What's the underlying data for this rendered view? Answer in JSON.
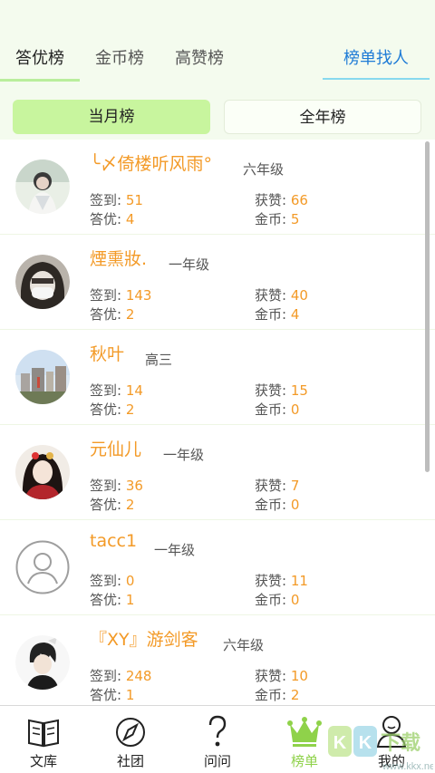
{
  "tabs": [
    {
      "label": "答优榜"
    },
    {
      "label": "金币榜"
    },
    {
      "label": "高赞榜"
    },
    {
      "label": "榜单找人"
    }
  ],
  "segments": {
    "month": "当月榜",
    "year": "全年榜"
  },
  "labels": {
    "sign": "签到:",
    "like": "获赞:",
    "answer": "答优:",
    "coin": "金币:"
  },
  "users": [
    {
      "name": "╰〆倚楼听风雨°",
      "grade": "六年级",
      "sign": "51",
      "like": "66",
      "answer": "4",
      "coin": "5"
    },
    {
      "name": "煙熏妝.",
      "grade": "一年级",
      "sign": "143",
      "like": "40",
      "answer": "2",
      "coin": "4"
    },
    {
      "name": "秋叶",
      "grade": "高三",
      "sign": "14",
      "like": "15",
      "answer": "2",
      "coin": "0"
    },
    {
      "name": "元仙儿",
      "grade": "一年级",
      "sign": "36",
      "like": "7",
      "answer": "2",
      "coin": "0"
    },
    {
      "name": "tacc1",
      "grade": "一年级",
      "sign": "0",
      "like": "11",
      "answer": "1",
      "coin": "0"
    },
    {
      "name": "『XY』游剑客",
      "grade": "六年级",
      "sign": "248",
      "like": "10",
      "answer": "1",
      "coin": "2"
    }
  ],
  "nav": [
    {
      "label": "文库",
      "icon": "book-icon"
    },
    {
      "label": "社团",
      "icon": "compass-icon"
    },
    {
      "label": "问问",
      "icon": "question-icon"
    },
    {
      "label": "榜单",
      "icon": "crown-icon"
    },
    {
      "label": "我的",
      "icon": "user-icon"
    }
  ],
  "watermark": "KK下载",
  "watermark_url": "www.kkx.net",
  "colors": {
    "accent_green": "#8fd24a",
    "highlight_orange": "#f39a27",
    "link_blue": "#1e7bd6"
  }
}
